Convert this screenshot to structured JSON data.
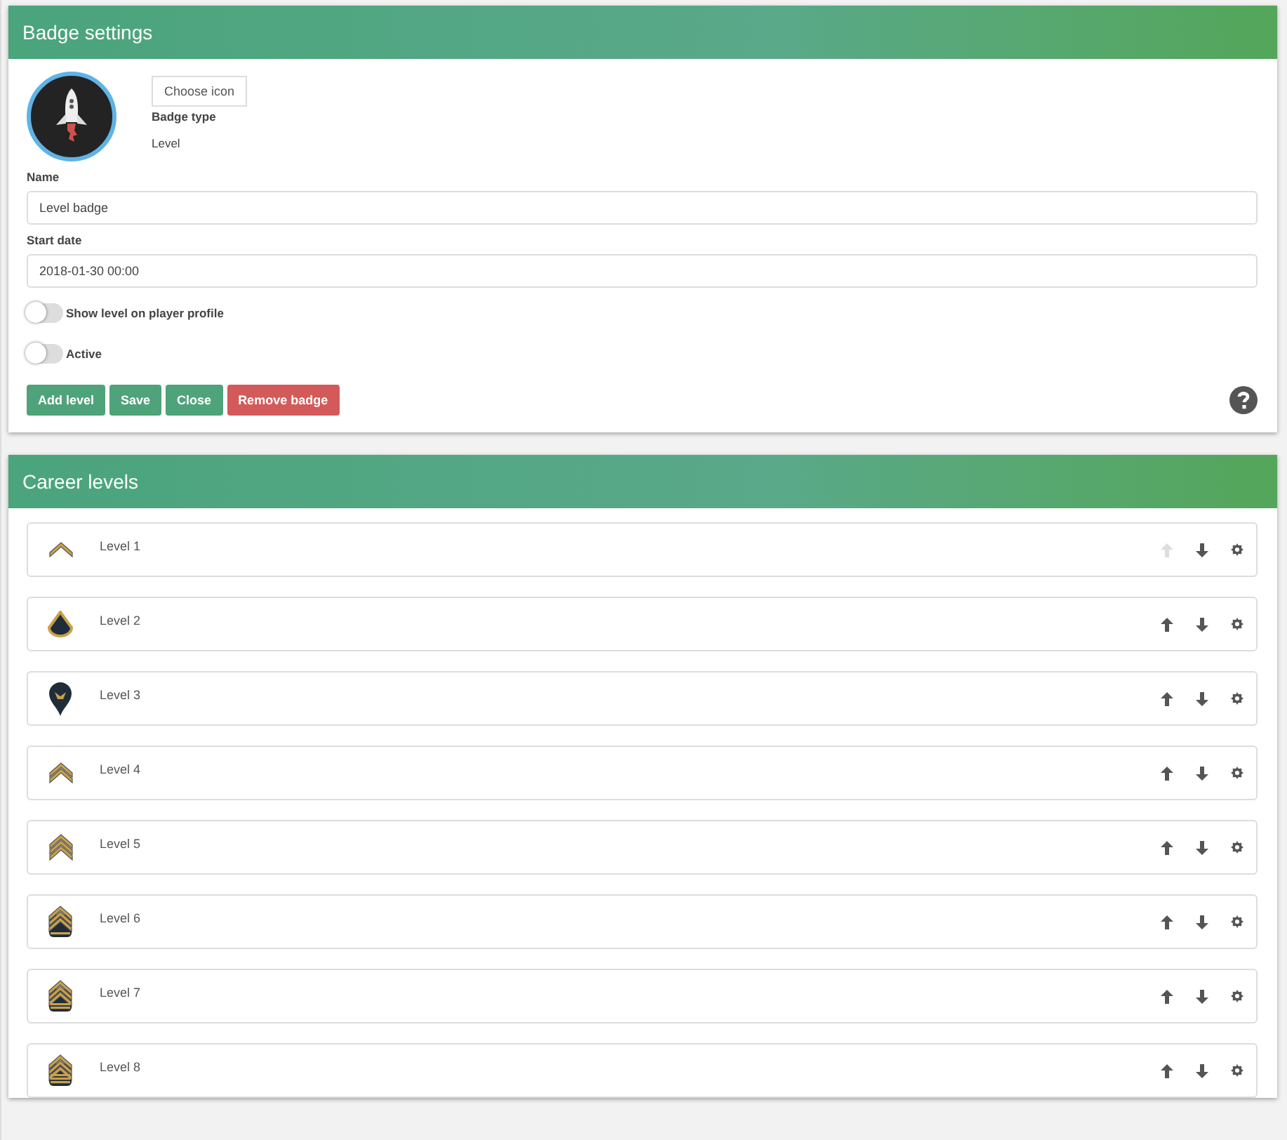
{
  "badge_panel": {
    "title": "Badge settings",
    "choose_icon": "Choose icon",
    "badge_type_label": "Badge type",
    "badge_type": "Level",
    "name_label": "Name",
    "name_value": "Level badge",
    "start_date_label": "Start date",
    "start_date_value": "2018-01-30 00:00",
    "toggles": [
      {
        "label": "Show level on player profile",
        "on": false
      },
      {
        "label": "Active",
        "on": false
      }
    ],
    "buttons": [
      {
        "label": "Add level",
        "kind": "primary"
      },
      {
        "label": "Save",
        "kind": "primary"
      },
      {
        "label": "Close",
        "kind": "primary"
      },
      {
        "label": "Remove badge",
        "kind": "danger"
      }
    ]
  },
  "levels_panel": {
    "title": "Career levels",
    "levels": [
      {
        "name": "Level 1",
        "kind": "private",
        "up_disabled": true
      },
      {
        "name": "Level 2",
        "kind": "pfc",
        "up_disabled": false
      },
      {
        "name": "Level 3",
        "kind": "specialist",
        "up_disabled": false
      },
      {
        "name": "Level 4",
        "kind": "corporal",
        "up_disabled": false
      },
      {
        "name": "Level 5",
        "kind": "sergeant",
        "up_disabled": false
      },
      {
        "name": "Level 6",
        "kind": "staff",
        "up_disabled": false
      },
      {
        "name": "Level 7",
        "kind": "first",
        "up_disabled": false
      },
      {
        "name": "Level 8",
        "kind": "master",
        "up_disabled": false
      }
    ]
  }
}
